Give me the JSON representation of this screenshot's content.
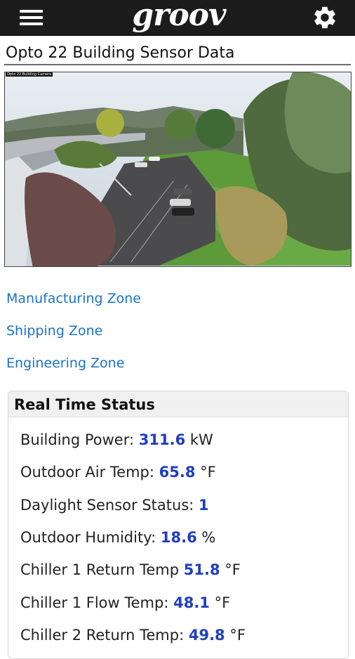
{
  "app": {
    "logo_text": "groov"
  },
  "header": {
    "menu_icon": "hamburger-menu-icon",
    "settings_icon": "gear-icon"
  },
  "page": {
    "title": "Opto 22 Building Sensor Data"
  },
  "camera": {
    "stamp": "Opto 22 Building Camera"
  },
  "zones": [
    {
      "label": "Manufacturing Zone"
    },
    {
      "label": "Shipping Zone"
    },
    {
      "label": "Engineering Zone"
    }
  ],
  "status": {
    "title": "Real Time Status",
    "rows": [
      {
        "label": "Building Power:",
        "value": "311.6",
        "unit": "kW"
      },
      {
        "label": "Outdoor Air Temp:",
        "value": "65.8",
        "unit": "°F"
      },
      {
        "label": "Daylight Sensor Status:",
        "value": "1",
        "unit": ""
      },
      {
        "label": "Outdoor Humidity:",
        "value": "18.6",
        "unit": "%"
      },
      {
        "label": "Chiller 1 Return Temp",
        "value": "51.8",
        "unit": "°F"
      },
      {
        "label": "Chiller 1 Flow Temp:",
        "value": "48.1",
        "unit": "°F"
      },
      {
        "label": "Chiller 2 Return Temp:",
        "value": "49.8",
        "unit": "°F"
      }
    ]
  },
  "colors": {
    "topbar": "#1c1c1c",
    "link": "#1a73c8",
    "value": "#1f3fbf"
  }
}
